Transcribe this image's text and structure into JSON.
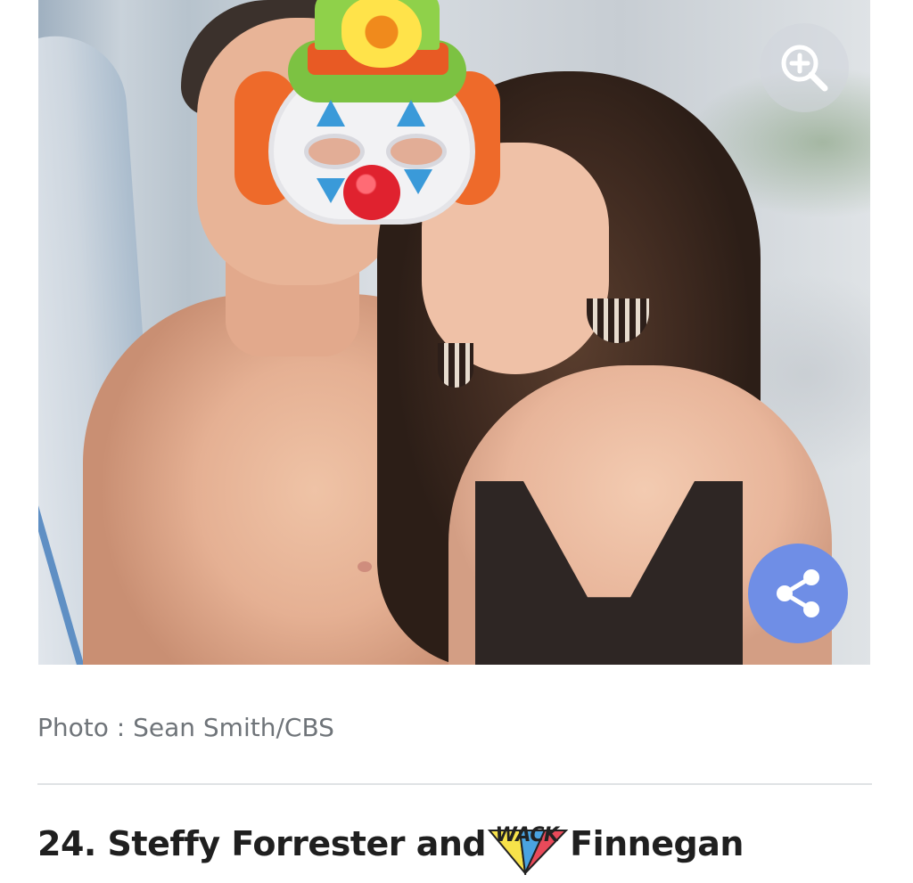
{
  "image": {
    "alt": "Photo : Sean Smith/CBS",
    "sticker_text": "WACK"
  },
  "buttons": {
    "zoom_icon": "zoom-in-icon",
    "share_icon": "share-icon"
  },
  "caption": "Photo : Sean Smith/CBS",
  "heading": {
    "before": "24. Steffy Forrester and ",
    "after": "Finnegan"
  },
  "colors": {
    "share_button": "#6f8ee6",
    "zoom_button": "#d2d6dc",
    "divider": "#dfe2e5",
    "caption": "#6f7479",
    "heading": "#1f1f1f"
  }
}
